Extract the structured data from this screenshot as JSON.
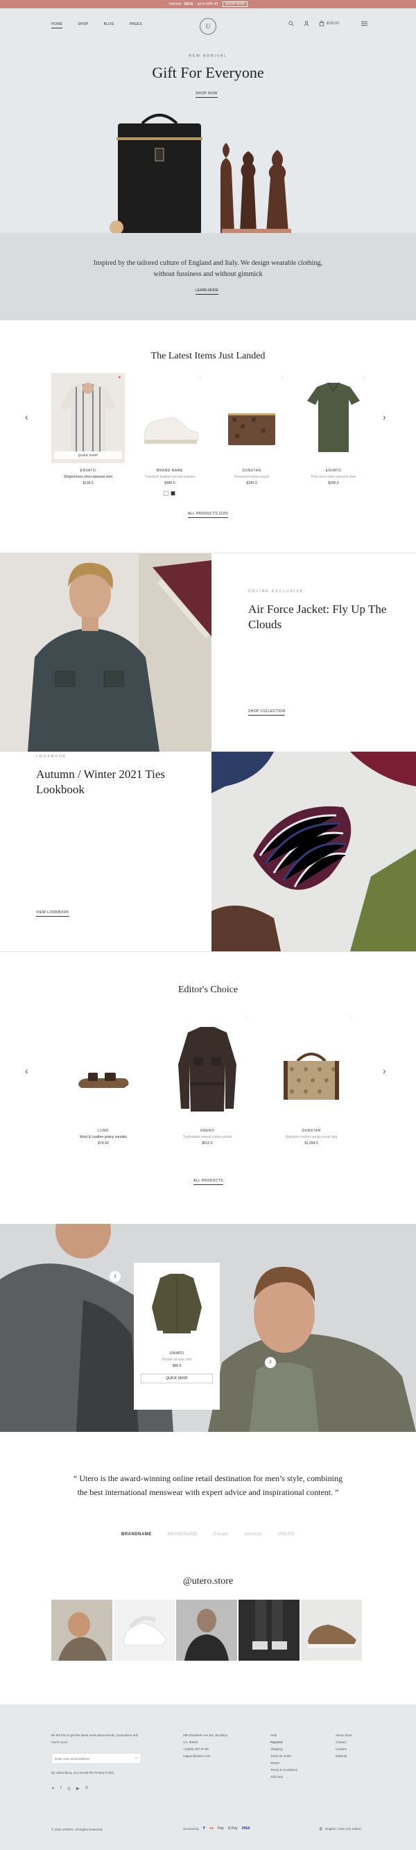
{
  "topbar": {
    "text_pre": "Summer",
    "highlight": "SALE",
    "text_post": "- up to 50% off",
    "button": "SHOP NOW"
  },
  "nav": {
    "items": [
      "HOME",
      "SHOP",
      "BLOG",
      "PAGES"
    ],
    "logo": "U",
    "cart_total": "$226.00",
    "search_icon": "search-icon",
    "account_icon": "user-icon",
    "cart_icon": "bag-icon",
    "menu_icon": "menu-icon"
  },
  "hero": {
    "eyebrow": "NEW ARRIVAL",
    "title": "Gift For Everyone",
    "button": "SHOP NOW"
  },
  "intro": {
    "text": "Inspired by the tailored culture of England and Italy. We design wearable clothing, without fussiness and without gimmick",
    "button": "LEARN MORE"
  },
  "latest": {
    "title": "The Latest Items Just Landed",
    "products": [
      {
        "brand": "ENVATO",
        "name": "Striped linen short-sleeved shirt",
        "price": "$135.5",
        "quick_shop": "QUICK SHOP"
      },
      {
        "brand": "BRAND NAME",
        "name": "Trackfoot leather low-top trainers",
        "price": "$440.0"
      },
      {
        "brand": "DUNSTAN",
        "name": "Textured-leather pouch",
        "price": "$140.0"
      },
      {
        "brand": "ENVATO",
        "name": "Polo wool short-sleeved shirt",
        "price": "$290.0"
      }
    ],
    "button": "ALL PRODUCTS (220)"
  },
  "promo1": {
    "eyebrow": "ONLINE EXCLUSIVE",
    "title": "Air Force Jacket: Fly Up The Clouds",
    "button": "SHOP COLLECTION"
  },
  "promo2": {
    "eyebrow": "LOOKBOOK",
    "title": "Autumn / Winter 2021 Ties Lookbook",
    "button": "VIEW LOOKBOOK"
  },
  "editors": {
    "title": "Editor's Choice",
    "products": [
      {
        "brand": "LUNO",
        "name": "Wool & Leather grainy sandals",
        "price": "$74.99"
      },
      {
        "brand": "UNERO",
        "name": "Trailmaster waxed cotton jacket",
        "price": "$612.9"
      },
      {
        "brand": "DUNSTAN",
        "name": "Nanterre-leather vanity travel bag",
        "price": "$1,094.5"
      }
    ],
    "button": "ALL PRODUCTS"
  },
  "lookbook": {
    "brand": "ENVATO",
    "name": "Pocket oil-wax shirt",
    "price": "$68.9",
    "button": "QUICK SHOP",
    "hotspot1": "1",
    "hotspot2": "2"
  },
  "quote": {
    "text": "“ Utero is the award-winning online retail destination for men’s style, combining the best international menswear with expert advice and inspirational content. ”"
  },
  "brands": [
    "BRANDNAME",
    "BRANDNAME",
    "Envato",
    "dunstan",
    "UNERO"
  ],
  "instagram": {
    "title": "@utero.store"
  },
  "footer": {
    "newsletter": "Be the first to get the latest news about trends, promotions and much more!",
    "email_placeholder": "Enter your email address",
    "terms": "By subscribing, you accept the Privacy Policy",
    "address": [
      "268 Elizabeth Ave Ste, Brooklyn,",
      "CA, 90022",
      "+1(800) 367 87 90",
      "support@utero.com"
    ],
    "links1": [
      "Help",
      "Payment",
      "Shipping",
      "Track an Order",
      "Return",
      "Terms & Conditions",
      "Gift Card"
    ],
    "links2": [
      "About Store",
      "Contact",
      "Careers",
      "Editorial"
    ],
    "copyright": "© 2021 UTERO. All Rights Reserved.",
    "secured_by": "Secured by",
    "payments": [
      "P",
      "●●",
      "Pay",
      "G Pay",
      "VISA"
    ],
    "language": "English / USD (US Dollar)"
  }
}
